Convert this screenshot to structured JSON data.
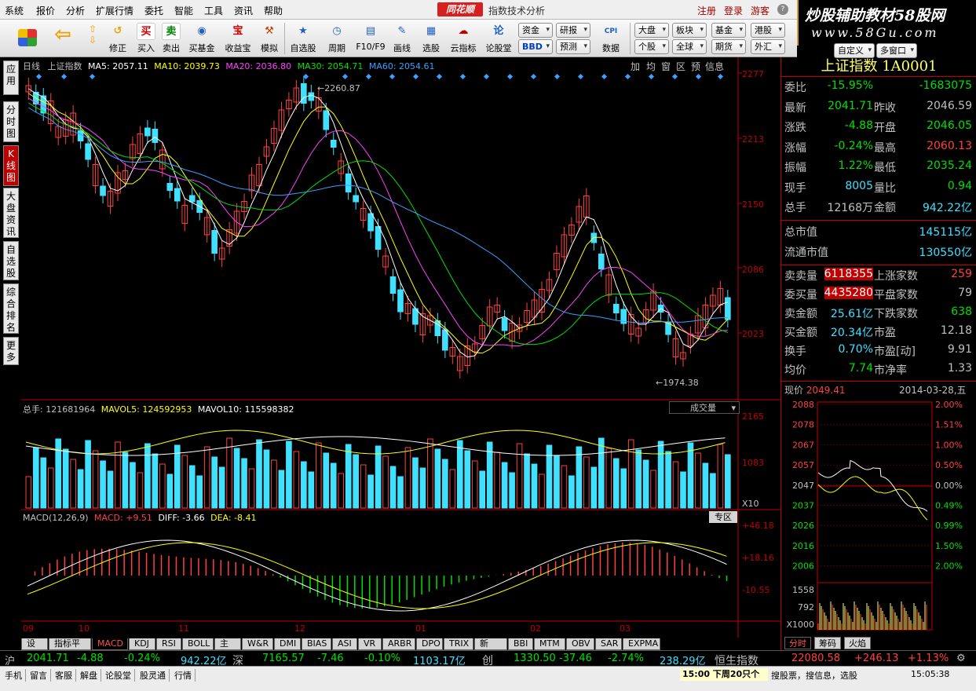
{
  "menu": [
    "系统",
    "报价",
    "分析",
    "扩展行情",
    "委托",
    "智能",
    "工具",
    "资讯",
    "帮助"
  ],
  "brand": "同花顺",
  "window_title": "指数技术分析",
  "top_links": [
    "注册",
    "登录",
    "游客"
  ],
  "promo": {
    "title": "炒股辅助教材58股网",
    "url": "www.58Gu.com"
  },
  "toolbar": {
    "buttons": [
      {
        "label": "修正",
        "icon": "↺",
        "color": "#f0a000"
      },
      {
        "label": "买入",
        "icon": "买",
        "color": "#d00000"
      },
      {
        "label": "卖出",
        "icon": "卖",
        "color": "#008000"
      },
      {
        "label": "买基金",
        "icon": "◉",
        "color": "#2060c0"
      },
      {
        "label": "收益宝",
        "icon": "宝",
        "color": "#d00000"
      },
      {
        "label": "模拟",
        "icon": "⚒",
        "color": "#c04000"
      },
      {
        "label": "自选股",
        "icon": "★",
        "color": "#2060c0"
      },
      {
        "label": "周期",
        "icon": "◷",
        "color": "#2060c0"
      },
      {
        "label": "F10/F9",
        "icon": "▤",
        "color": "#2060c0"
      },
      {
        "label": "画线",
        "icon": "✎",
        "color": "#2060c0"
      },
      {
        "label": "选股",
        "icon": "▦",
        "color": "#2060c0"
      },
      {
        "label": "云指标",
        "icon": "☁",
        "color": "#c00000"
      },
      {
        "label": "论股堂",
        "icon": "论",
        "color": "#2060c0"
      },
      {
        "label": "数据",
        "icon": "CPI",
        "color": "#2060c0"
      }
    ],
    "small_buttons": [
      "资金",
      "BBD",
      "研报",
      "预测",
      "大盘",
      "个股",
      "板块",
      "全球",
      "基金",
      "期货",
      "港股",
      "外汇",
      "自定义",
      "多窗口"
    ]
  },
  "left_tabs": [
    "应用",
    "分时图",
    "K线图",
    "大盘资讯",
    "自选股",
    "综合排名",
    "更多"
  ],
  "chart": {
    "period": "日线",
    "name": "上证指数",
    "ma": [
      {
        "label": "MA5: 2057.11",
        "color": "#ffffff"
      },
      {
        "label": "MA10: 2039.73",
        "color": "#ffff00"
      },
      {
        "label": "MA20: 2036.80",
        "color": "#ff40ff"
      },
      {
        "label": "MA30: 2054.71",
        "color": "#00e000"
      },
      {
        "label": "MA60: 2054.61",
        "color": "#3aa0ff"
      }
    ],
    "tools": [
      "加",
      "均",
      "窗",
      "区",
      "预",
      "信息"
    ],
    "price_axis": [
      "2277",
      "2213",
      "2150",
      "2086",
      "2023"
    ],
    "high_label": "2260.87",
    "low_label": "1974.38",
    "volume_info": {
      "label": "总手: 121681964",
      "mavol5": "MAVOL5: 124592953",
      "mavol10": "MAVOL10: 115598382"
    },
    "volume_dropdown": "成交量",
    "volume_axis": [
      "2165",
      "1083",
      "X10"
    ],
    "macd_info": {
      "label": "MACD(12,26,9)",
      "macd": "MACD: +9.51",
      "diff": "DIFF: -3.66",
      "dea": "DEA: -8.41"
    },
    "macd_zone": "专区",
    "macd_axis": [
      "+46.18",
      "+18.16",
      "-10.55"
    ],
    "dates": [
      "09",
      "10",
      "11",
      "12",
      "01",
      "02",
      "03"
    ]
  },
  "indicator_tabs": [
    "设置",
    "指标平台",
    "MACD",
    "KDJ",
    "RSI",
    "BOLL",
    "主力",
    "W&R",
    "DMI",
    "BIAS",
    "ASI",
    "VR",
    "ARBR",
    "DPO",
    "TRIX",
    "新DMA",
    "BBI",
    "MTM",
    "OBV",
    "SAR",
    "EXPMA"
  ],
  "right_panel": {
    "title": "上证指数 1A0001",
    "rows": [
      {
        "l1": "委比",
        "v1": "-15.95%",
        "c1": "g",
        "l2": "",
        "v2": "-1683075",
        "c2": "g"
      },
      {
        "l1": "最新",
        "v1": "2041.71",
        "c1": "g",
        "l2": "昨收",
        "v2": "2046.59",
        "c2": "w"
      },
      {
        "l1": "涨跌",
        "v1": "-4.88",
        "c1": "g",
        "l2": "开盘",
        "v2": "2046.05",
        "c2": "g"
      },
      {
        "l1": "涨幅",
        "v1": "-0.24%",
        "c1": "g",
        "l2": "最高",
        "v2": "2060.13",
        "c2": "r"
      },
      {
        "l1": "振幅",
        "v1": "1.22%",
        "c1": "g",
        "l2": "最低",
        "v2": "2035.24",
        "c2": "g"
      },
      {
        "l1": "现手",
        "v1": "8005",
        "c1": "c",
        "l2": "量比",
        "v2": "0.94",
        "c2": "g"
      },
      {
        "l1": "总手",
        "v1": "12168万",
        "c1": "w",
        "l2": "金额",
        "v2": "942.22亿",
        "c2": "c"
      }
    ],
    "rows2": [
      {
        "l": "总市值",
        "v": "145115亿",
        "c": "c"
      },
      {
        "l": "流通市值",
        "v": "130550亿",
        "c": "c"
      }
    ],
    "rows3": [
      {
        "l1": "卖卖量",
        "v1": "6118355",
        "c1": "w",
        "l2": "上涨家数",
        "v2": "259",
        "c2": "r"
      },
      {
        "l1": "委买量",
        "v1": "4435280",
        "c1": "w",
        "l2": "平盘家数",
        "v2": "79",
        "c2": "w"
      },
      {
        "l1": "卖金额",
        "v1": "25.61亿",
        "c1": "c",
        "l2": "下跌家数",
        "v2": "638",
        "c2": "g"
      },
      {
        "l1": "买金额",
        "v1": "20.34亿",
        "c1": "c",
        "l2": "市盈",
        "v2": "12.18",
        "c2": "w"
      },
      {
        "l1": "换手",
        "v1": "0.70%",
        "c1": "c",
        "l2": "市盈[动]",
        "v2": "9.91",
        "c2": "w"
      },
      {
        "l1": "均价",
        "v1": "7.74",
        "c1": "g",
        "l2": "市净率",
        "v2": "1.33",
        "c2": "w"
      }
    ],
    "price_label": "现价",
    "price_value": "2049.41",
    "date": "2014-03-28,五",
    "mini_left_axis": [
      "2088",
      "2078",
      "2067",
      "2057",
      "2047",
      "2037",
      "2026",
      "2016",
      "2006",
      "1558",
      "792",
      "X1000"
    ],
    "mini_right_axis": [
      "2.00%",
      "1.51%",
      "1.00%",
      "0.50%",
      "0.00%",
      "0.49%",
      "0.99%",
      "1.50%",
      "2.00%"
    ],
    "tabs": [
      "分时",
      "筹码",
      "火焰"
    ]
  },
  "quote_bar": [
    {
      "t": "沪",
      "c": "w"
    },
    {
      "t": "2041.71",
      "c": "g"
    },
    {
      "t": "-4.88",
      "c": "g"
    },
    {
      "t": "-0.24%",
      "c": "g"
    },
    {
      "t": "942.22亿",
      "c": "c"
    },
    {
      "t": "深",
      "c": "w"
    },
    {
      "t": "7165.57",
      "c": "g"
    },
    {
      "t": "-7.46",
      "c": "g"
    },
    {
      "t": "-0.10%",
      "c": "g"
    },
    {
      "t": "1103.17亿",
      "c": "c"
    },
    {
      "t": "创",
      "c": "w"
    },
    {
      "t": "1330.50",
      "c": "g"
    },
    {
      "t": "-37.46",
      "c": "g"
    },
    {
      "t": "-2.74%",
      "c": "g"
    },
    {
      "t": "238.29亿",
      "c": "c"
    },
    {
      "t": "恒生指数",
      "c": "w"
    },
    {
      "t": "22080.58",
      "c": "r"
    },
    {
      "t": "+246.13",
      "c": "r"
    },
    {
      "t": "+1.13%",
      "c": "r"
    }
  ],
  "status_bar": {
    "items": [
      "手机",
      "留言",
      "客服",
      "解盘",
      "论股堂",
      "股灵通",
      "行情"
    ],
    "ticker": "15:00 下周20只个",
    "ticker2": "搜股票，搜信息，选股",
    "clock": "15:05:38"
  },
  "colors": {
    "up": "#ff4040",
    "down": "#40e0ff",
    "axis": "#c00000",
    "bg": "#000000"
  }
}
